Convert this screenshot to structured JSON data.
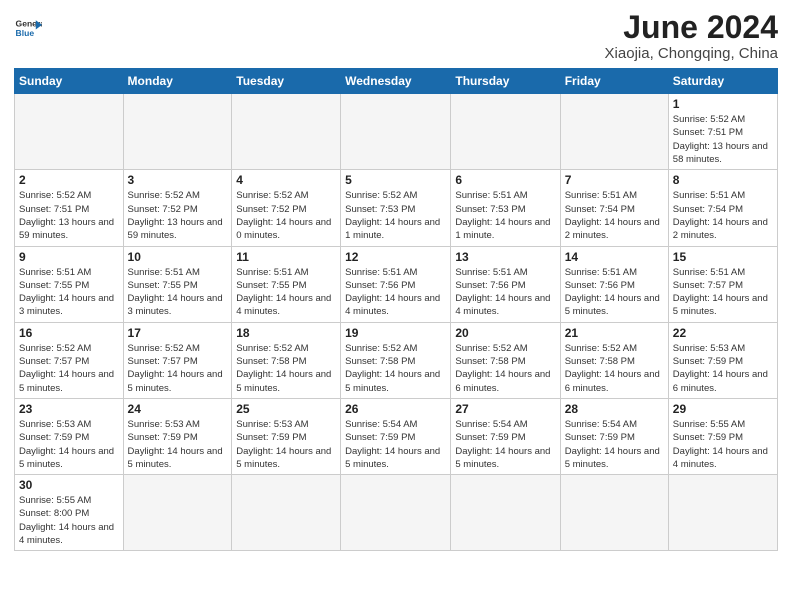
{
  "logo": {
    "line1": "General",
    "line2": "Blue"
  },
  "title": "June 2024",
  "location": "Xiaojia, Chongqing, China",
  "weekdays": [
    "Sunday",
    "Monday",
    "Tuesday",
    "Wednesday",
    "Thursday",
    "Friday",
    "Saturday"
  ],
  "weeks": [
    [
      {
        "num": "",
        "info": ""
      },
      {
        "num": "",
        "info": ""
      },
      {
        "num": "",
        "info": ""
      },
      {
        "num": "",
        "info": ""
      },
      {
        "num": "",
        "info": ""
      },
      {
        "num": "",
        "info": ""
      },
      {
        "num": "1",
        "info": "Sunrise: 5:52 AM\nSunset: 7:51 PM\nDaylight: 13 hours and 58 minutes."
      }
    ],
    [
      {
        "num": "2",
        "info": "Sunrise: 5:52 AM\nSunset: 7:51 PM\nDaylight: 13 hours and 59 minutes."
      },
      {
        "num": "3",
        "info": "Sunrise: 5:52 AM\nSunset: 7:52 PM\nDaylight: 13 hours and 59 minutes."
      },
      {
        "num": "4",
        "info": "Sunrise: 5:52 AM\nSunset: 7:52 PM\nDaylight: 14 hours and 0 minutes."
      },
      {
        "num": "5",
        "info": "Sunrise: 5:52 AM\nSunset: 7:53 PM\nDaylight: 14 hours and 1 minute."
      },
      {
        "num": "6",
        "info": "Sunrise: 5:51 AM\nSunset: 7:53 PM\nDaylight: 14 hours and 1 minute."
      },
      {
        "num": "7",
        "info": "Sunrise: 5:51 AM\nSunset: 7:54 PM\nDaylight: 14 hours and 2 minutes."
      },
      {
        "num": "8",
        "info": "Sunrise: 5:51 AM\nSunset: 7:54 PM\nDaylight: 14 hours and 2 minutes."
      }
    ],
    [
      {
        "num": "9",
        "info": "Sunrise: 5:51 AM\nSunset: 7:55 PM\nDaylight: 14 hours and 3 minutes."
      },
      {
        "num": "10",
        "info": "Sunrise: 5:51 AM\nSunset: 7:55 PM\nDaylight: 14 hours and 3 minutes."
      },
      {
        "num": "11",
        "info": "Sunrise: 5:51 AM\nSunset: 7:55 PM\nDaylight: 14 hours and 4 minutes."
      },
      {
        "num": "12",
        "info": "Sunrise: 5:51 AM\nSunset: 7:56 PM\nDaylight: 14 hours and 4 minutes."
      },
      {
        "num": "13",
        "info": "Sunrise: 5:51 AM\nSunset: 7:56 PM\nDaylight: 14 hours and 4 minutes."
      },
      {
        "num": "14",
        "info": "Sunrise: 5:51 AM\nSunset: 7:56 PM\nDaylight: 14 hours and 5 minutes."
      },
      {
        "num": "15",
        "info": "Sunrise: 5:51 AM\nSunset: 7:57 PM\nDaylight: 14 hours and 5 minutes."
      }
    ],
    [
      {
        "num": "16",
        "info": "Sunrise: 5:52 AM\nSunset: 7:57 PM\nDaylight: 14 hours and 5 minutes."
      },
      {
        "num": "17",
        "info": "Sunrise: 5:52 AM\nSunset: 7:57 PM\nDaylight: 14 hours and 5 minutes."
      },
      {
        "num": "18",
        "info": "Sunrise: 5:52 AM\nSunset: 7:58 PM\nDaylight: 14 hours and 5 minutes."
      },
      {
        "num": "19",
        "info": "Sunrise: 5:52 AM\nSunset: 7:58 PM\nDaylight: 14 hours and 5 minutes."
      },
      {
        "num": "20",
        "info": "Sunrise: 5:52 AM\nSunset: 7:58 PM\nDaylight: 14 hours and 6 minutes."
      },
      {
        "num": "21",
        "info": "Sunrise: 5:52 AM\nSunset: 7:58 PM\nDaylight: 14 hours and 6 minutes."
      },
      {
        "num": "22",
        "info": "Sunrise: 5:53 AM\nSunset: 7:59 PM\nDaylight: 14 hours and 6 minutes."
      }
    ],
    [
      {
        "num": "23",
        "info": "Sunrise: 5:53 AM\nSunset: 7:59 PM\nDaylight: 14 hours and 5 minutes."
      },
      {
        "num": "24",
        "info": "Sunrise: 5:53 AM\nSunset: 7:59 PM\nDaylight: 14 hours and 5 minutes."
      },
      {
        "num": "25",
        "info": "Sunrise: 5:53 AM\nSunset: 7:59 PM\nDaylight: 14 hours and 5 minutes."
      },
      {
        "num": "26",
        "info": "Sunrise: 5:54 AM\nSunset: 7:59 PM\nDaylight: 14 hours and 5 minutes."
      },
      {
        "num": "27",
        "info": "Sunrise: 5:54 AM\nSunset: 7:59 PM\nDaylight: 14 hours and 5 minutes."
      },
      {
        "num": "28",
        "info": "Sunrise: 5:54 AM\nSunset: 7:59 PM\nDaylight: 14 hours and 5 minutes."
      },
      {
        "num": "29",
        "info": "Sunrise: 5:55 AM\nSunset: 7:59 PM\nDaylight: 14 hours and 4 minutes."
      }
    ],
    [
      {
        "num": "30",
        "info": "Sunrise: 5:55 AM\nSunset: 8:00 PM\nDaylight: 14 hours and 4 minutes."
      },
      {
        "num": "",
        "info": ""
      },
      {
        "num": "",
        "info": ""
      },
      {
        "num": "",
        "info": ""
      },
      {
        "num": "",
        "info": ""
      },
      {
        "num": "",
        "info": ""
      },
      {
        "num": "",
        "info": ""
      }
    ]
  ]
}
